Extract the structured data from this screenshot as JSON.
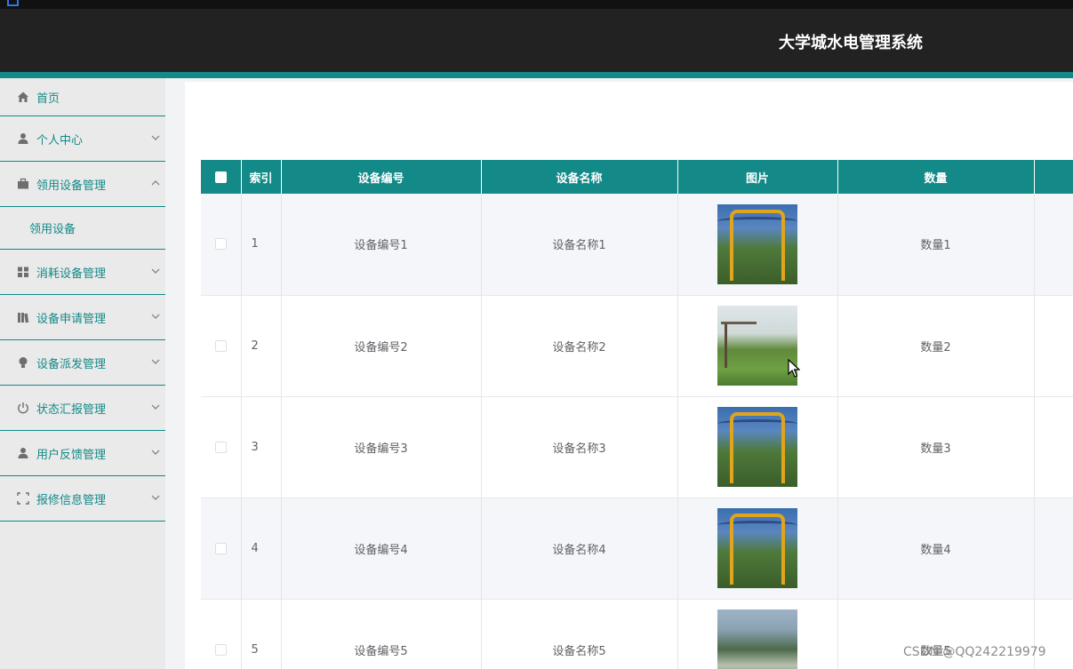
{
  "header": {
    "title": "大学城水电管理系统"
  },
  "sidebar": {
    "items": [
      {
        "label": "首页",
        "icon": "home-icon",
        "expandable": false
      },
      {
        "label": "个人中心",
        "icon": "user-icon",
        "expandable": true
      },
      {
        "label": "领用设备管理",
        "icon": "briefcase-icon",
        "expandable": true,
        "expanded": true,
        "children": [
          "领用设备"
        ]
      },
      {
        "label": "消耗设备管理",
        "icon": "grid-icon",
        "expandable": true
      },
      {
        "label": "设备申请管理",
        "icon": "books-icon",
        "expandable": true
      },
      {
        "label": "设备派发管理",
        "icon": "bulb-icon",
        "expandable": true
      },
      {
        "label": "状态汇报管理",
        "icon": "power-icon",
        "expandable": true
      },
      {
        "label": "用户反馈管理",
        "icon": "user-icon",
        "expandable": true
      },
      {
        "label": "报修信息管理",
        "icon": "fullscreen-icon",
        "expandable": true
      }
    ]
  },
  "table": {
    "columns": [
      "索引",
      "设备编号",
      "设备名称",
      "图片",
      "数量"
    ],
    "rows": [
      {
        "index": "1",
        "code": "设备编号1",
        "name": "设备名称1",
        "image": "crane",
        "qty": "数量1"
      },
      {
        "index": "2",
        "code": "设备编号2",
        "name": "设备名称2",
        "image": "field",
        "qty": "数量2"
      },
      {
        "index": "3",
        "code": "设备编号3",
        "name": "设备名称3",
        "image": "crane",
        "qty": "数量3"
      },
      {
        "index": "4",
        "code": "设备编号4",
        "name": "设备名称4",
        "image": "crane",
        "qty": "数量4"
      },
      {
        "index": "5",
        "code": "设备编号5",
        "name": "设备名称5",
        "image": "city",
        "qty": "数量5"
      }
    ]
  },
  "watermark": "CSDN @QQ242219979",
  "colors": {
    "accent": "#138a88",
    "header_bg": "#222222",
    "sidebar_bg": "#eaeaea"
  }
}
